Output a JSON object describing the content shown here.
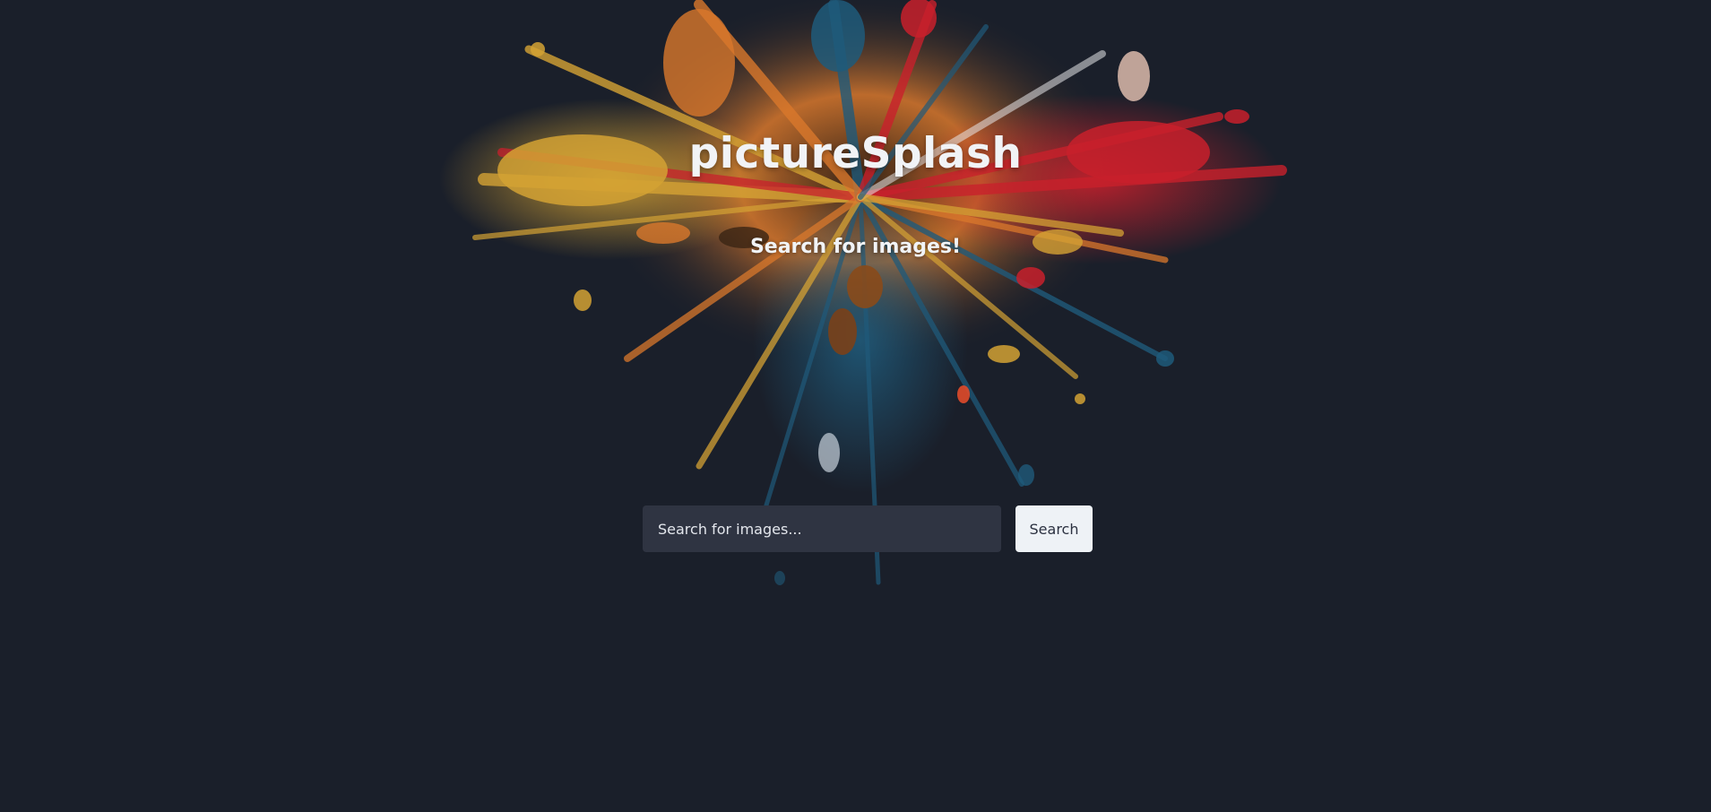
{
  "app": {
    "title": "pictureSplash",
    "subtitle": "Search for images!"
  },
  "search": {
    "placeholder": "Search for images...",
    "value": "",
    "button_label": "Search"
  },
  "colors": {
    "background": "#1a1f2a",
    "input_background": "#2f3442",
    "button_background": "#eef2f6",
    "splash_palette": [
      "#d8a93a",
      "#e38a2e",
      "#c9202e",
      "#1f5a7a",
      "#e8e8ea"
    ]
  },
  "icons": {
    "hero_image": "paint-splash-illustration"
  }
}
